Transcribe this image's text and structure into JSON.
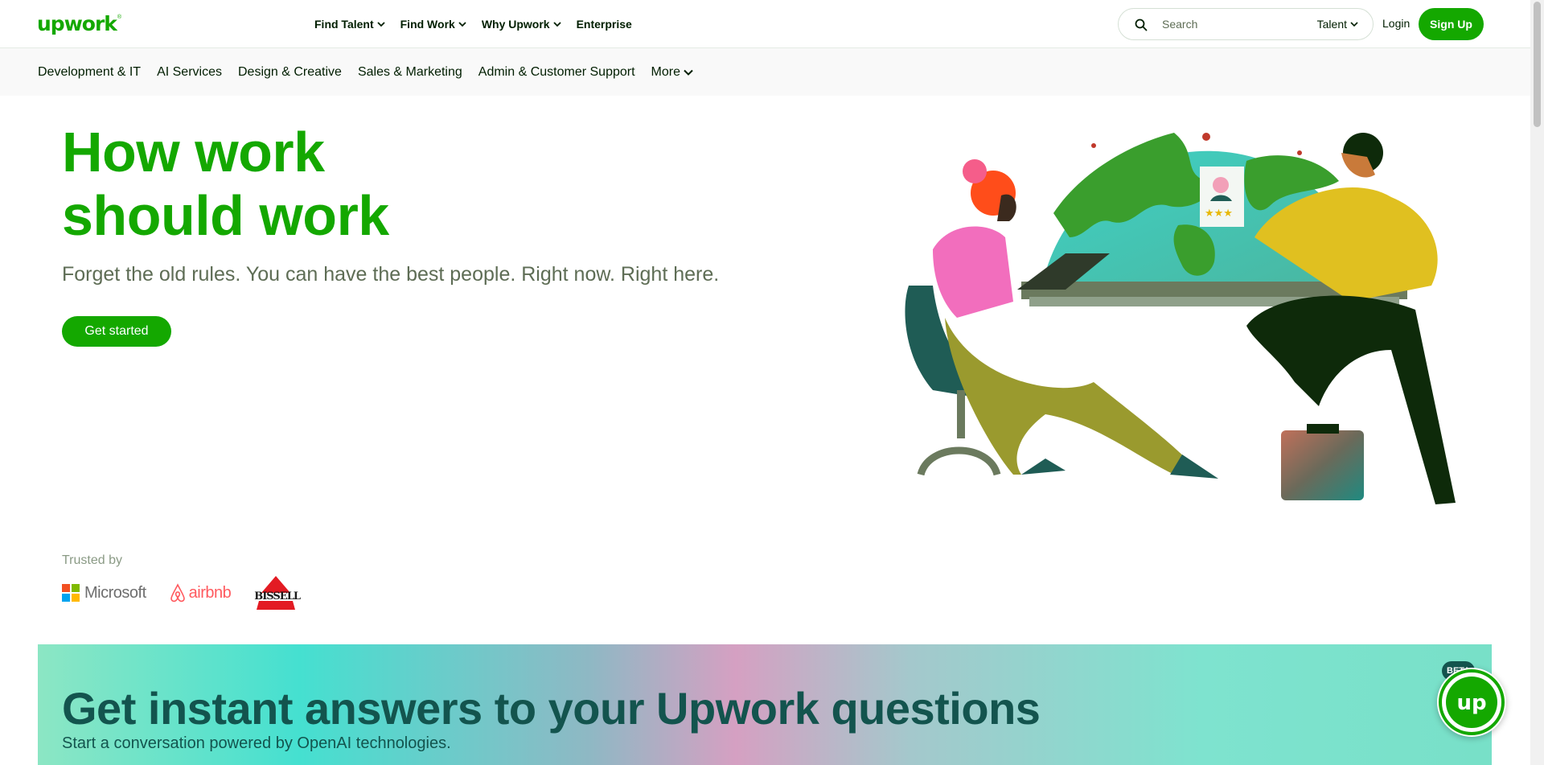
{
  "header": {
    "logo_text": "upwork",
    "nav": [
      {
        "label": "Find Talent",
        "has_dropdown": true
      },
      {
        "label": "Find Work",
        "has_dropdown": true
      },
      {
        "label": "Why Upwork",
        "has_dropdown": true
      },
      {
        "label": "Enterprise",
        "has_dropdown": false
      }
    ],
    "search": {
      "placeholder": "Search",
      "scope": "Talent"
    },
    "login_label": "Login",
    "signup_label": "Sign Up"
  },
  "subnav": {
    "items": [
      "Development & IT",
      "AI Services",
      "Design & Creative",
      "Sales & Marketing",
      "Admin & Customer Support",
      "More"
    ]
  },
  "hero": {
    "title_line1": "How work",
    "title_line2": "should work",
    "subtitle": "Forget the old rules. You can have the best people. Right now. Right here.",
    "cta_label": "Get started"
  },
  "trusted": {
    "label": "Trusted by",
    "logos": [
      "Microsoft",
      "airbnb",
      "BISSELL"
    ]
  },
  "banner": {
    "title": "Get instant answers to your Upwork questions",
    "subtitle": "Start a conversation powered by OpenAI technologies.",
    "badge": "BETA"
  },
  "colors": {
    "brand_green": "#14a800",
    "text_dark": "#001e00",
    "banner_text": "#13544e"
  },
  "icons": [
    "search-icon",
    "chevron-down-icon",
    "upwork-chat-icon"
  ]
}
